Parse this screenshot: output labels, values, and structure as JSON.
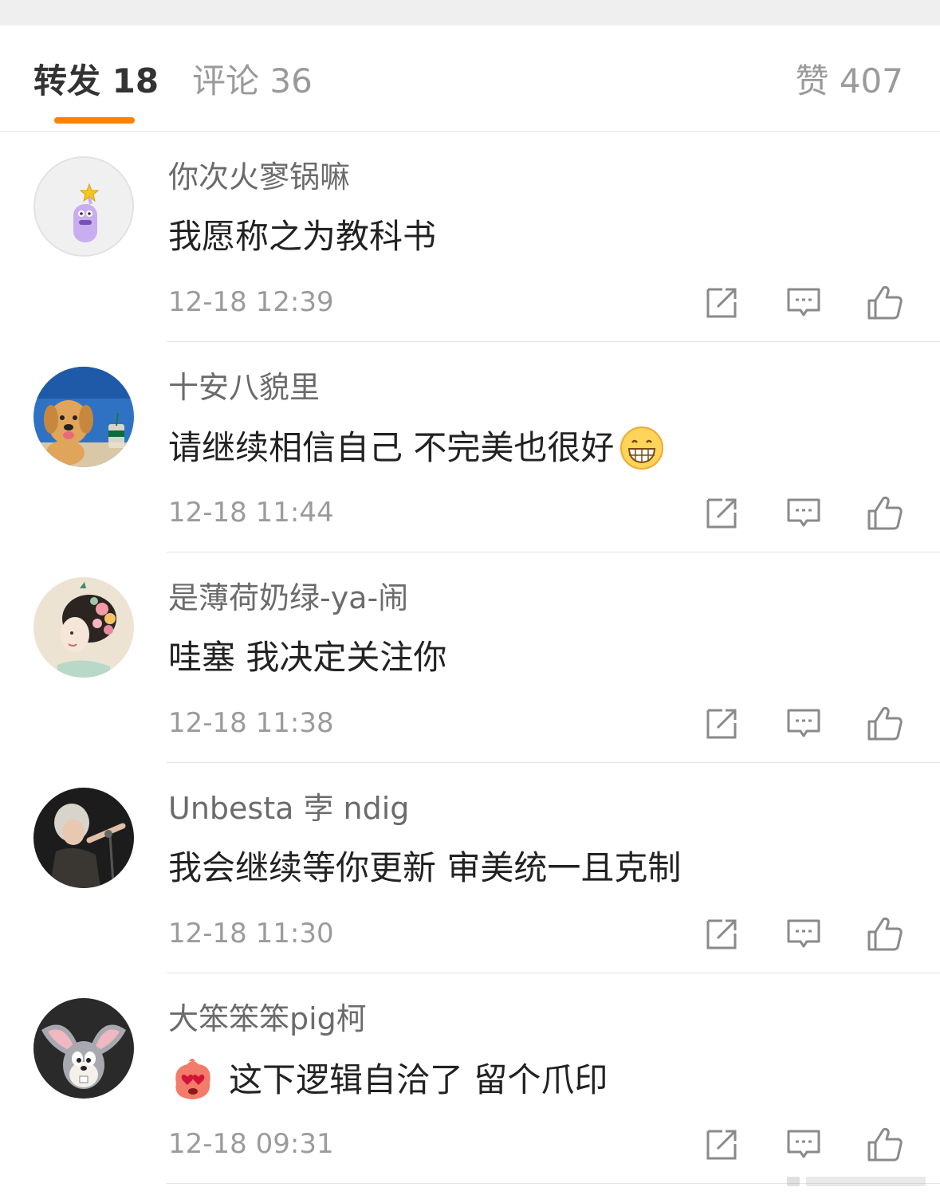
{
  "tabs": {
    "repost": "转发 18",
    "comment": "评论 36",
    "like": "赞 407"
  },
  "colors": {
    "accent": "#ff8200",
    "username": "#6b6b6b",
    "timestamp": "#9b9b9b"
  },
  "comments": [
    {
      "username": "你次火寥锅嘛",
      "content": "我愿称之为教科书",
      "time": "12-18 12:39",
      "avatar_icon": "purple-monster-with-star-avatar"
    },
    {
      "username": "十安八貌里",
      "content": "请继续相信自己 不完美也很好",
      "time": "12-18 11:44",
      "avatar_icon": "golden-retriever-puppy-avatar",
      "trailing_emoji": "grinning-face-emoji"
    },
    {
      "username": "是薄荷奶绿-ya-闹",
      "content": "哇塞 我决定关注你",
      "time": "12-18 11:38",
      "avatar_icon": "illustrated-girl-with-flowers-avatar"
    },
    {
      "username": "Unbesta 孛 ndig",
      "content": "我会继续等你更新 审美统一且克制",
      "time": "12-18 11:30",
      "avatar_icon": "singer-photo-avatar"
    },
    {
      "username": "大笨笨笨pig柯",
      "content": "这下逻辑自洽了 留个爪印",
      "time": "12-18 09:31",
      "avatar_icon": "cartoon-rabbit-avatar",
      "leading_emoji": "heart-eyes-blob-emoji"
    }
  ]
}
